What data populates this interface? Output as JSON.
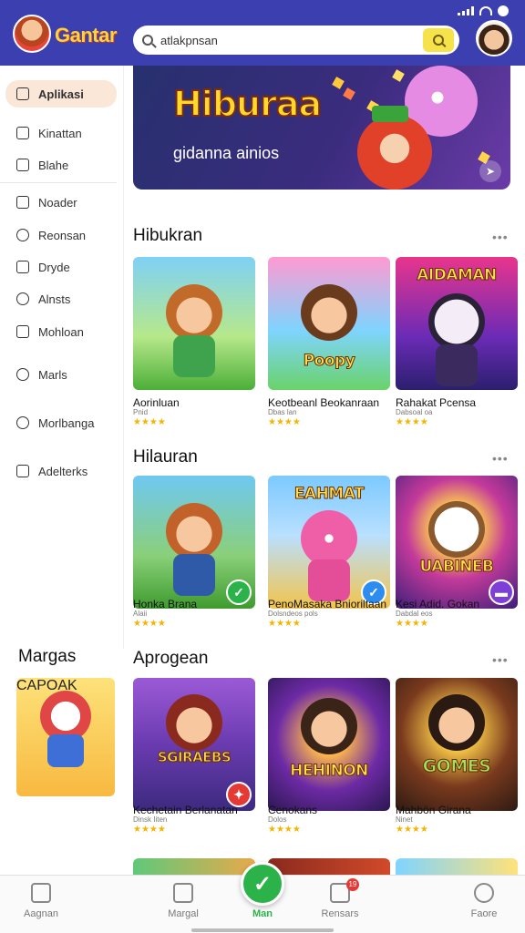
{
  "header": {
    "app_name": "Gantar",
    "search_value": "atlakpnsan"
  },
  "sidebar": {
    "items": [
      {
        "label": "Aplikasi",
        "icon": "home-icon"
      },
      {
        "label": "Kinattan",
        "icon": "window-icon"
      },
      {
        "label": "Blahe",
        "icon": "screen-icon"
      },
      {
        "label": "Noader",
        "icon": "folder-icon"
      },
      {
        "label": "Reonsan",
        "icon": "people-icon"
      },
      {
        "label": "Dryde",
        "icon": "gamepad-icon"
      },
      {
        "label": "Alnsts",
        "icon": "chat-icon"
      },
      {
        "label": "Mohloan",
        "icon": "chart-icon"
      },
      {
        "label": "Marls",
        "icon": "bubble-icon"
      },
      {
        "label": "Morlbanga",
        "icon": "heart-icon"
      },
      {
        "label": "Adelterks",
        "icon": "image-icon"
      }
    ]
  },
  "hero": {
    "title": "Hiburaa",
    "subtitle": "gidanna ainios"
  },
  "sections": [
    {
      "title": "Hibukran",
      "games": [
        {
          "title": "Aorinluan",
          "sub": "Pnid",
          "rating": "★★★★",
          "art_word": ""
        },
        {
          "title": "Keotbeanl Beokanraan",
          "sub": "Dbas lan",
          "rating": "★★★★",
          "art_word": "Poopy"
        },
        {
          "title": "Rahakat Pcensa",
          "sub": "Dabsoal oa",
          "rating": "★★★★",
          "art_word": "AIDAMAN"
        }
      ]
    },
    {
      "title": "Hilauran",
      "games": [
        {
          "title": "Honka Brana",
          "sub": "Alaii",
          "rating": "★★★★",
          "art_word": ""
        },
        {
          "title": "PenoMasaka Bnioriltaan",
          "sub": "Dolsndeos pols",
          "rating": "★★★★",
          "art_word": "EAHMAT"
        },
        {
          "title": "Kesi Adid. Gokan",
          "sub": "Dabdal eos",
          "rating": "★★★★",
          "art_word": "UABINEB"
        }
      ]
    },
    {
      "title": "Aprogean",
      "games": [
        {
          "title": "Kechetain Berlanatan",
          "sub": "Dinsk Iiten",
          "rating": "★★★★",
          "art_word": "SGIRAEBS"
        },
        {
          "title": "Cenokans",
          "sub": "Dolos",
          "rating": "★★★★",
          "art_word": "HEHINON"
        },
        {
          "title": "Mahbön Girana",
          "sub": "Ninet",
          "rating": "★★★★",
          "art_word": "GOMES"
        }
      ]
    }
  ],
  "left_panel": {
    "title": "Margas",
    "art_word": "CAPOAK"
  },
  "bottom_nav": {
    "items": [
      {
        "label": "Aagnan",
        "icon": "home-icon"
      },
      {
        "label": "Margal",
        "icon": "box-icon"
      },
      {
        "label": "Rensars",
        "icon": "inbox-icon"
      },
      {
        "label": "Faore",
        "icon": "person-icon"
      }
    ],
    "center_label": "Man",
    "notif_count": "19"
  }
}
